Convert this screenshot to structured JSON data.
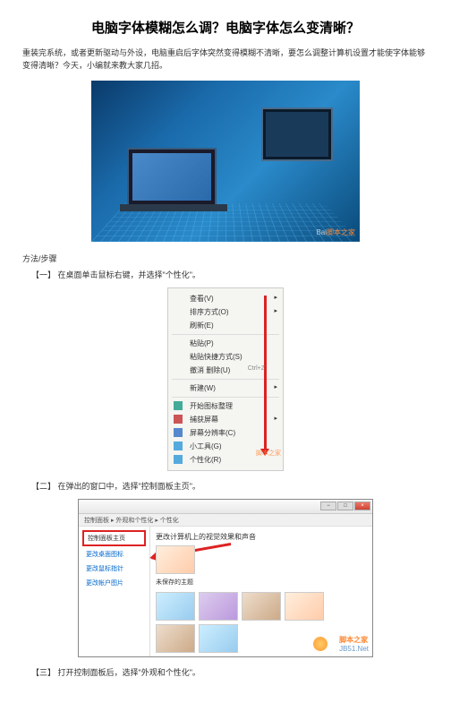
{
  "title": "电脑字体模糊怎么调？电脑字体怎么变清晰？",
  "intro": "重装完系统，或者更新驱动与外设，电脑重启后字体突然变得模糊不清晰，要怎么调整计算机设置才能使字体能够变得清晰？今天，小编就来教大家几招。",
  "hero_watermark_prefix": "Bai",
  "hero_watermark_brand": "脚本之家",
  "section_label": "方法/步骤",
  "steps": {
    "s1": {
      "num": "【一】",
      "text": "在桌面单击鼠标右键，并选择\"个性化\"。"
    },
    "s2": {
      "num": "【二】",
      "text": "在弹出的窗口中，选择\"控制面板主页\"。"
    },
    "s3": {
      "num": "【三】",
      "text": "打开控制面板后，选择\"外观和个性化\"。"
    }
  },
  "context_menu": {
    "items": [
      {
        "label": "查看(V)",
        "sub": true
      },
      {
        "label": "排序方式(O)",
        "sub": true
      },
      {
        "label": "刷新(E)"
      }
    ],
    "items2": [
      {
        "label": "粘贴(P)"
      },
      {
        "label": "粘贴快捷方式(S)"
      },
      {
        "label": "撤消 删除(U)",
        "shortcut": "Ctrl+Z"
      }
    ],
    "items3": [
      {
        "label": "新建(W)",
        "sub": true
      }
    ],
    "items4": [
      {
        "label": "开始图标整理",
        "icon": "#4a9"
      },
      {
        "label": "捕获屏幕",
        "icon": "#c55",
        "sub": true
      },
      {
        "label": "屏幕分辨率(C)",
        "icon": "#58c"
      },
      {
        "label": "小工具(G)",
        "icon": "#5ad"
      },
      {
        "label": "个性化(R)",
        "icon": "#5ad"
      }
    ],
    "watermark": "脚本之家"
  },
  "window": {
    "toolbar": "控制面板 ▸ 外观和个性化 ▸ 个性化",
    "sidebar": {
      "item_selected": "控制面板主页",
      "items": [
        "更改桌面图标",
        "更改鼠标指针",
        "更改帐户图片"
      ]
    },
    "main_title": "更改计算机上的视觉效果和声音",
    "theme_label": "未保存的主题",
    "watermark_brand": "脚本之家",
    "watermark_site": "JB51.Net"
  }
}
